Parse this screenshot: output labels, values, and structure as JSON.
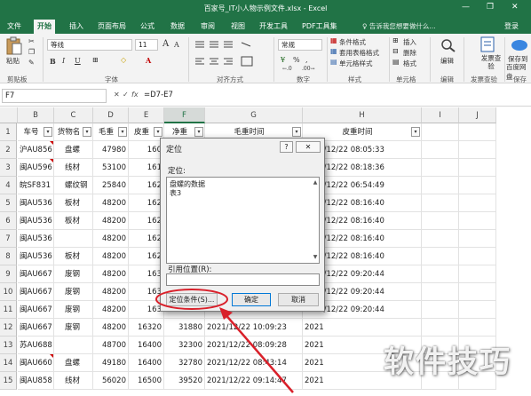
{
  "window": {
    "title": "百家号_IT小人物示例文件.xlsx - Excel",
    "min": "—",
    "restore": "❐",
    "close": "✕"
  },
  "tabs": [
    "文件",
    "开始",
    "插入",
    "页面布局",
    "公式",
    "数据",
    "审阅",
    "视图",
    "开发工具",
    "PDF工具集"
  ],
  "active_tab": "开始",
  "tell_me": "♀ 告诉我您想要做什么...",
  "login": "登录",
  "ribbon": {
    "paste": "粘贴",
    "clipboard": "剪贴板",
    "font_name": "等线",
    "font_size": "11",
    "font_group": "字体",
    "align_group": "对齐方式",
    "number_format": "常规",
    "number_group": "数字",
    "cond_format": "条件格式",
    "table_format": "套用表格格式",
    "cell_style": "单元格样式",
    "style_group": "样式",
    "insert": "插入",
    "delete": "删除",
    "format": "格式",
    "cells_group": "单元格",
    "edit": "编辑",
    "edit_group": "编辑",
    "invoice_check": "发票查验",
    "invoice_group": "发票查验",
    "save_baidu_1": "保存到",
    "save_baidu_2": "百度网盘",
    "save_group": "保存",
    "pct": "%",
    "comma": ",",
    "currency": "¥",
    "bold": "B",
    "italic": "I",
    "underline": "U",
    "font_color": "A",
    "grow_font": "A",
    "shrink_font": "A",
    "fill": "◇",
    "border": "⊞",
    "decimal_inc": "←.0",
    "decimal_dec": ".00→"
  },
  "formula_bar": {
    "name_box": "F7",
    "cancel": "✕",
    "enter": "✓",
    "fx": "fx",
    "formula": "=D7-E7"
  },
  "columns": [
    "B",
    "C",
    "D",
    "E",
    "F",
    "G",
    "H",
    "I",
    "J"
  ],
  "rows": [
    {
      "n": "1",
      "cells": [
        "车号",
        "货物名",
        "毛重",
        "皮重",
        "净重",
        "毛重时间",
        "皮重时间",
        "",
        ""
      ]
    },
    {
      "n": "2",
      "cells": [
        "沪AU856",
        "盘螺",
        "47980",
        "160",
        "",
        "",
        "2021/12/22 08:05:33",
        "",
        ""
      ]
    },
    {
      "n": "3",
      "cells": [
        "闽AU596",
        "线材",
        "53100",
        "161",
        "",
        "",
        "2021/12/22 08:18:36",
        "",
        ""
      ]
    },
    {
      "n": "4",
      "cells": [
        "皖SF831",
        "螺纹钢",
        "25840",
        "162",
        "",
        "",
        "2021/12/22 06:54:49",
        "",
        ""
      ]
    },
    {
      "n": "5",
      "cells": [
        "闽AU536",
        "板材",
        "48200",
        "162",
        "",
        "",
        "2021/12/22 08:16:40",
        "",
        ""
      ]
    },
    {
      "n": "6",
      "cells": [
        "闽AU536",
        "板材",
        "48200",
        "162",
        "",
        "",
        "2021/12/22 08:16:40",
        "",
        ""
      ]
    },
    {
      "n": "7",
      "cells": [
        "闽AU536",
        "",
        "48200",
        "162",
        "",
        "",
        "2021/12/22 08:16:40",
        "",
        ""
      ]
    },
    {
      "n": "8",
      "cells": [
        "闽AU536",
        "板材",
        "48200",
        "162",
        "",
        "",
        "2021/12/22 08:16:40",
        "",
        ""
      ]
    },
    {
      "n": "9",
      "cells": [
        "闽AU667",
        "废钢",
        "48200",
        "163",
        "",
        "",
        "2021/12/22 09:20:44",
        "",
        ""
      ]
    },
    {
      "n": "10",
      "cells": [
        "闽AU667",
        "废钢",
        "48200",
        "163",
        "",
        "",
        "2021/12/22 09:20:44",
        "",
        ""
      ]
    },
    {
      "n": "11",
      "cells": [
        "闽AU667",
        "废钢",
        "48200",
        "163",
        "",
        "",
        "2021/12/22 09:20:44",
        "",
        ""
      ]
    },
    {
      "n": "12",
      "cells": [
        "闽AU667",
        "废钢",
        "48200",
        "16320",
        "31880",
        "2021/12/22 10:09:23",
        "2021",
        "",
        ""
      ]
    },
    {
      "n": "13",
      "cells": [
        "苏AU688",
        "",
        "48700",
        "16400",
        "32300",
        "2021/12/22 08:09:28",
        "2021",
        "",
        ""
      ]
    },
    {
      "n": "14",
      "cells": [
        "闽AU660",
        "盘螺",
        "49180",
        "16400",
        "32780",
        "2021/12/22 08:43:14",
        "2021",
        "",
        ""
      ]
    },
    {
      "n": "15",
      "cells": [
        "闽AU858",
        "线材",
        "56020",
        "16500",
        "39520",
        "2021/12/22 09:14:47",
        "2021",
        "",
        ""
      ]
    }
  ],
  "dialog": {
    "title": "定位",
    "help": "?",
    "close": "✕",
    "goto_label": "定位:",
    "list_items": [
      "盘螺的数据",
      "表3"
    ],
    "ref_label": "引用位置(R):",
    "ref_value": "",
    "special_button": "定位条件(S)...",
    "ok_button": "确定",
    "cancel_button": "取消"
  },
  "watermark": "软件技巧",
  "colors": {
    "excel_green": "#217346",
    "highlight_red": "#d9202a",
    "tri_red": "#c00000"
  }
}
